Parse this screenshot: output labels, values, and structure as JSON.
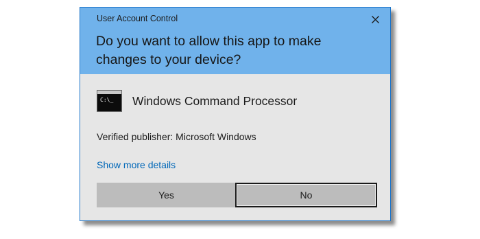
{
  "dialog": {
    "title": "User Account Control",
    "close_icon": "close-icon",
    "question": "Do you want to allow this app to make changes to your device?",
    "app": {
      "icon": "command-prompt-icon",
      "icon_prompt": "C:\\_",
      "name": "Windows Command Processor"
    },
    "publisher": "Verified publisher: Microsoft Windows",
    "details_link": "Show more details",
    "buttons": {
      "yes": "Yes",
      "no": "No"
    }
  },
  "colors": {
    "header": "#70b2eb",
    "body": "#e6e6e6",
    "link": "#0067b8",
    "button": "#bcbcbc"
  }
}
